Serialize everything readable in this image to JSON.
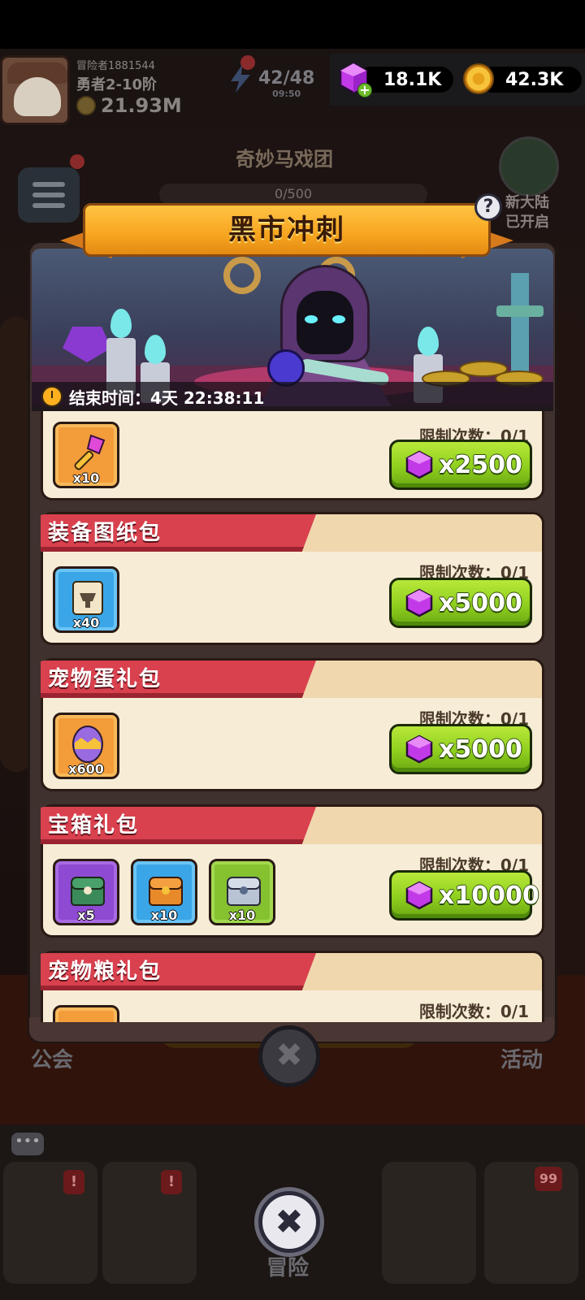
{
  "player": {
    "id": "冒险者1881544",
    "rank": "勇者2-10阶",
    "power": "21.93M"
  },
  "energy": {
    "value": "42/48",
    "timer": "09:50"
  },
  "currency": {
    "gems": "18.1K",
    "gold": "42.3K"
  },
  "background": {
    "event_title": "奇妙马戏团",
    "event_progress": "0/500",
    "new_continent": "新大陆\n已开启",
    "guild_label": "公会",
    "activity_label": "活动",
    "adventure_label": "冒险",
    "chest_badge": "99"
  },
  "modal": {
    "title": "黑市冲刺",
    "help": "?",
    "timer_label": "结束时间：4天 22:38:11",
    "close": "✖"
  },
  "packs": [
    {
      "title": "",
      "limit": "限制次数：0/1",
      "price": "x2500",
      "items": [
        {
          "icon": "key-icon",
          "qty": "x10",
          "bg": "orange"
        }
      ]
    },
    {
      "title": "装备图纸包",
      "limit": "限制次数：0/1",
      "price": "x5000",
      "items": [
        {
          "icon": "blueprint-scroll-icon",
          "qty": "x40",
          "bg": "blue"
        }
      ]
    },
    {
      "title": "宠物蛋礼包",
      "limit": "限制次数：0/1",
      "price": "x5000",
      "items": [
        {
          "icon": "pet-egg-icon",
          "qty": "x600",
          "bg": "orange"
        }
      ]
    },
    {
      "title": "宝箱礼包",
      "limit": "限制次数：0/1",
      "price": "x10000",
      "items": [
        {
          "icon": "green-chest-icon",
          "qty": "x5",
          "bg": "purple"
        },
        {
          "icon": "orange-chest-icon",
          "qty": "x10",
          "bg": "blue"
        },
        {
          "icon": "silver-chest-icon",
          "qty": "x10",
          "bg": "green"
        }
      ]
    },
    {
      "title": "宠物粮礼包",
      "limit": "限制次数：0/1",
      "price": "",
      "items": []
    }
  ],
  "colors": {
    "banner": "#f7a520",
    "card_title": "#d9414e",
    "buy_button": "#8fcf1e",
    "gem": "#b040e0"
  }
}
